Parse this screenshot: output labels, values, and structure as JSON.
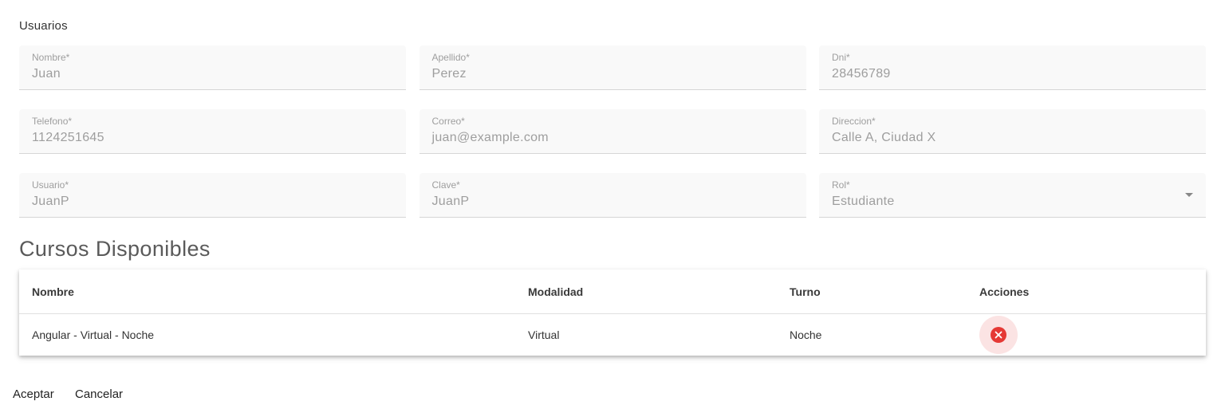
{
  "form": {
    "title": "Usuarios",
    "fields": [
      {
        "label": "Nombre*",
        "value": "Juan"
      },
      {
        "label": "Apellido*",
        "value": "Perez"
      },
      {
        "label": "Dni*",
        "value": "28456789"
      },
      {
        "label": "Telefono*",
        "value": "1124251645"
      },
      {
        "label": "Correo*",
        "value": "juan@example.com"
      },
      {
        "label": "Direccion*",
        "value": "Calle A, Ciudad X"
      },
      {
        "label": "Usuario*",
        "value": "JuanP"
      },
      {
        "label": "Clave*",
        "value": "JuanP"
      },
      {
        "label": "Rol*",
        "value": "Estudiante"
      }
    ]
  },
  "courses": {
    "title": "Cursos Disponibles",
    "columns": [
      "Nombre",
      "Modalidad",
      "Turno",
      "Acciones"
    ],
    "rows": [
      {
        "nombre": "Angular - Virtual - Noche",
        "modalidad": "Virtual",
        "turno": "Noche",
        "action_icon": "cancel-icon"
      }
    ]
  },
  "actions": {
    "accept_label": "Aceptar",
    "cancel_label": "Cancelar"
  },
  "colors": {
    "field_background": "#f9f9f9",
    "muted_text": "#9e9e9e",
    "danger": "#e53935",
    "danger_soft": "#fbe3e3"
  }
}
